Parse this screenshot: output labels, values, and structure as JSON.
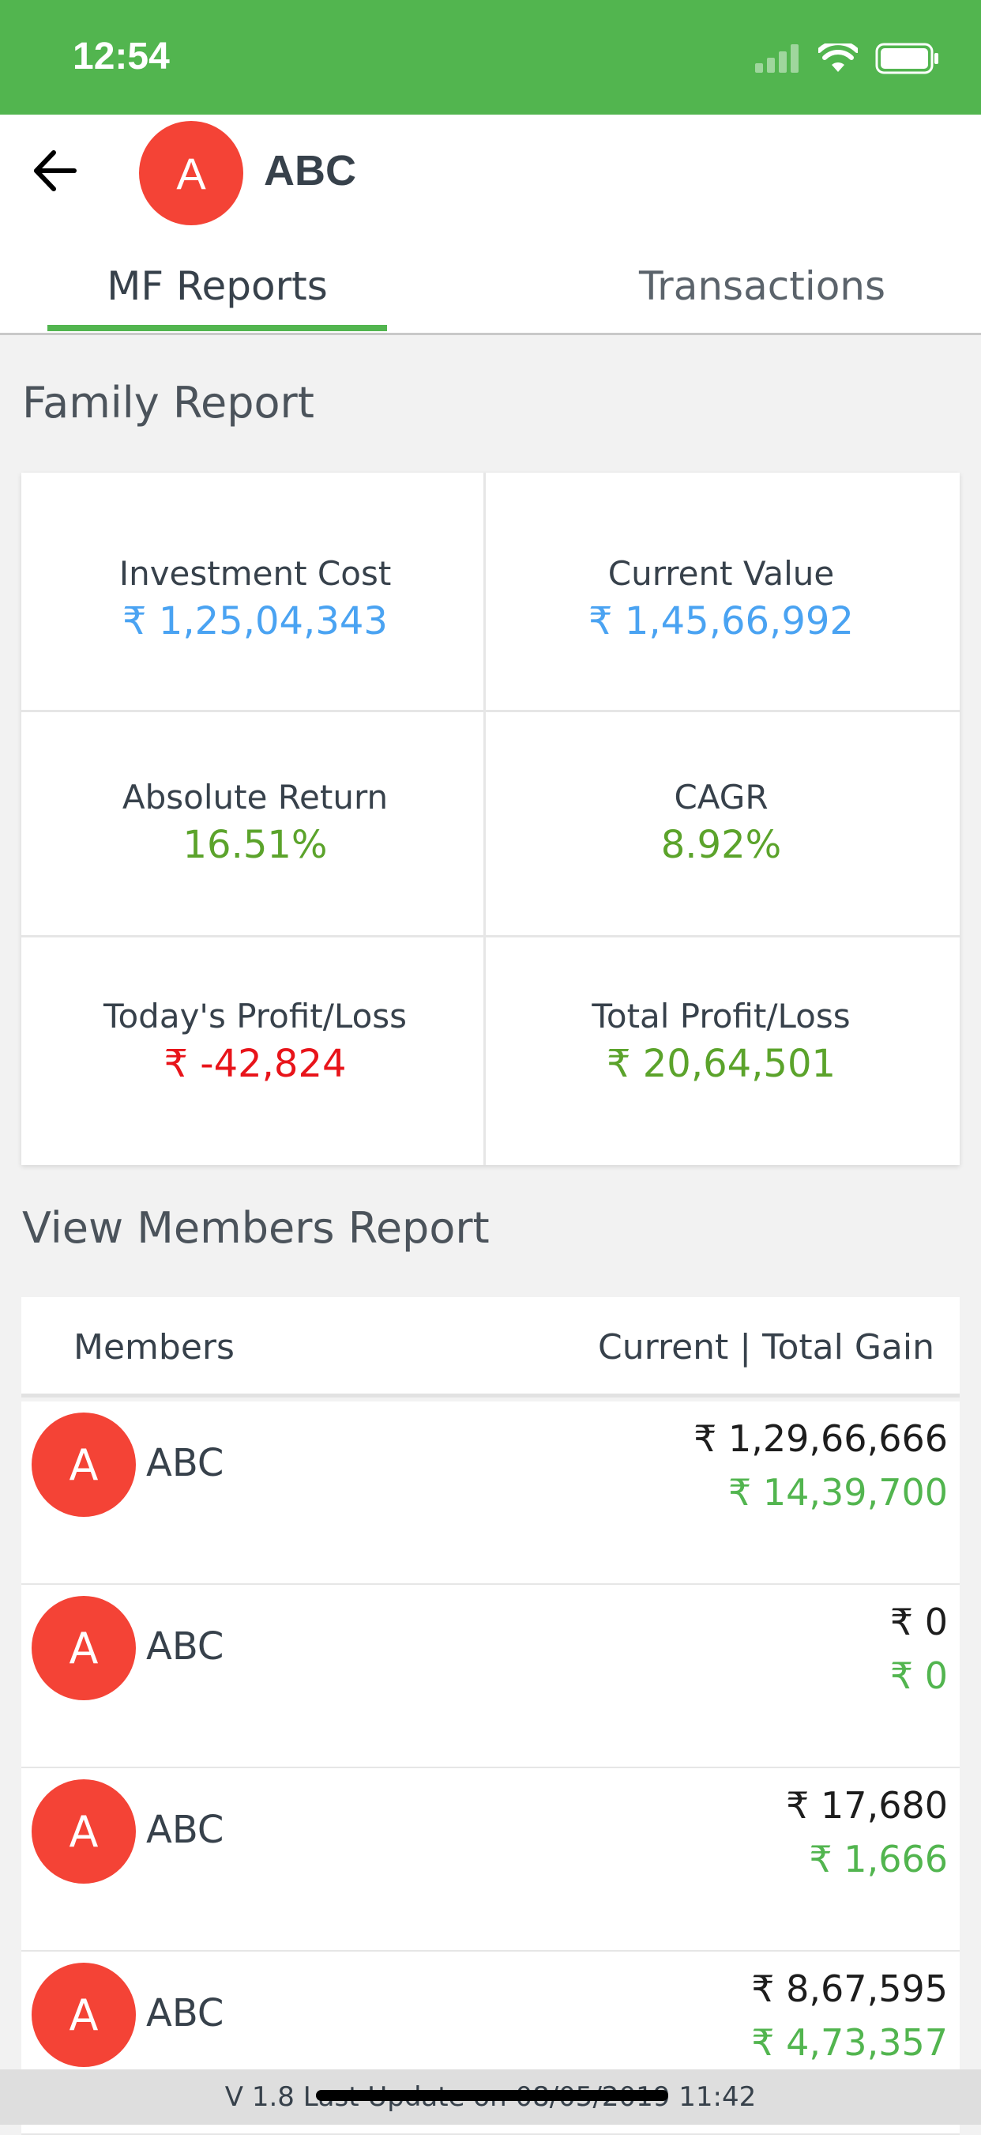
{
  "status_bar": {
    "time": "12:54",
    "icons": [
      "signal-icon",
      "wifi-icon",
      "battery-icon"
    ]
  },
  "header": {
    "avatar_letter": "A",
    "name": "ABC",
    "back_icon": "arrow-left-icon"
  },
  "tabs": [
    {
      "label": "MF Reports",
      "active": true
    },
    {
      "label": "Transactions",
      "active": false
    }
  ],
  "family_report": {
    "title": "Family Report",
    "investment_cost": {
      "label": "Investment Cost",
      "value": "₹ 1,25,04,343"
    },
    "current_value": {
      "label": "Current Value",
      "value": "₹ 1,45,66,992"
    },
    "absolute_return": {
      "label": "Absolute Return",
      "value": "16.51%"
    },
    "cagr": {
      "label": "CAGR",
      "value": "8.92%"
    },
    "todays_pl": {
      "label": "Today's Profit/Loss",
      "value": "₹ -42,824"
    },
    "total_pl": {
      "label": "Total Profit/Loss",
      "value": "₹ 20,64,501"
    }
  },
  "members_report": {
    "title": "View Members Report",
    "col_members": "Members",
    "col_current": "Current | Total Gain",
    "rows": [
      {
        "avatar": "A",
        "name": "ABC",
        "current": "₹ 1,29,66,666",
        "gain": "₹ 14,39,700"
      },
      {
        "avatar": "A",
        "name": "ABC",
        "current": "₹ 0",
        "gain": "₹ 0"
      },
      {
        "avatar": "A",
        "name": "ABC",
        "current": "₹ 17,680",
        "gain": "₹ 1,666"
      },
      {
        "avatar": "A",
        "name": "ABC",
        "current": "₹ 8,67,595",
        "gain": "₹ 4,73,357"
      }
    ]
  },
  "footer": {
    "text": "V  1.8   Last Update on 08/05/2019 11:42"
  },
  "colors": {
    "brand_green": "#52b54f",
    "avatar_red": "#f44336",
    "value_blue": "#4aa3f2",
    "loss_red": "#e8141a"
  }
}
